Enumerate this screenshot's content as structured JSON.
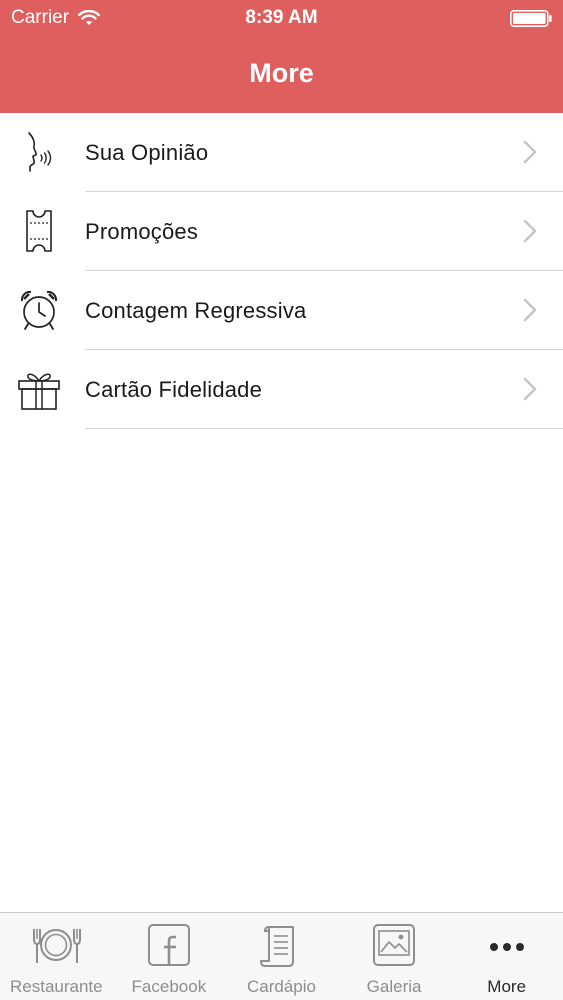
{
  "status_bar": {
    "carrier": "Carrier",
    "time": "8:39 AM"
  },
  "nav": {
    "title": "More"
  },
  "menu": {
    "items": [
      {
        "label": "Sua Opinião",
        "icon": "feedback-speech-icon"
      },
      {
        "label": "Promoções",
        "icon": "ticket-icon"
      },
      {
        "label": "Contagem Regressiva",
        "icon": "alarm-clock-icon"
      },
      {
        "label": "Cartão Fidelidade",
        "icon": "gift-icon"
      }
    ]
  },
  "tab_bar": {
    "tabs": [
      {
        "label": "Restaurante",
        "icon": "plate-cutlery-icon",
        "active": false
      },
      {
        "label": "Facebook",
        "icon": "facebook-icon",
        "active": false
      },
      {
        "label": "Cardápio",
        "icon": "scroll-menu-icon",
        "active": false
      },
      {
        "label": "Galeria",
        "icon": "gallery-image-icon",
        "active": false
      },
      {
        "label": "More",
        "icon": "more-dots-icon",
        "active": true
      }
    ]
  },
  "colors": {
    "header_bg": "#df5f5e",
    "separator": "#d5d5d5",
    "tab_inactive": "#8e8e8e",
    "tab_active": "#2a2a2a"
  }
}
